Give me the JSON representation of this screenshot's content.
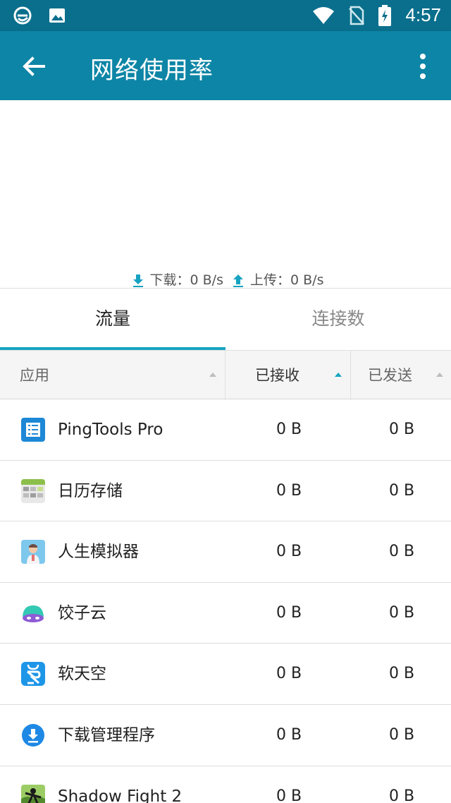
{
  "status_bar": {
    "time": "4:57"
  },
  "app_bar": {
    "title": "网络使用率"
  },
  "speed": {
    "download_label": "下载：0 B/s",
    "upload_label": "上传：0 B/s"
  },
  "tabs": [
    {
      "label": "流量"
    },
    {
      "label": "连接数"
    }
  ],
  "table": {
    "columns": [
      "应用",
      "已接收",
      "已发送"
    ],
    "rows": [
      {
        "app": "PingTools Pro",
        "received": "0 B",
        "sent": "0 B",
        "icon": "pingtools-icon"
      },
      {
        "app": "日历存储",
        "received": "0 B",
        "sent": "0 B",
        "icon": "calendar-storage-icon"
      },
      {
        "app": "人生模拟器",
        "received": "0 B",
        "sent": "0 B",
        "icon": "life-simulator-icon"
      },
      {
        "app": "饺子云",
        "received": "0 B",
        "sent": "0 B",
        "icon": "jiaoziyun-icon"
      },
      {
        "app": "软天空",
        "received": "0 B",
        "sent": "0 B",
        "icon": "ruantiankong-icon"
      },
      {
        "app": "下载管理程序",
        "received": "0 B",
        "sent": "0 B",
        "icon": "download-manager-icon"
      },
      {
        "app": "Shadow Fight 2",
        "received": "0 B",
        "sent": "0 B",
        "icon": "shadow-fight-icon"
      }
    ]
  },
  "colors": {
    "status_bar": "#0a6f8c",
    "app_bar": "#0d85a6",
    "accent": "#17a3c1"
  }
}
